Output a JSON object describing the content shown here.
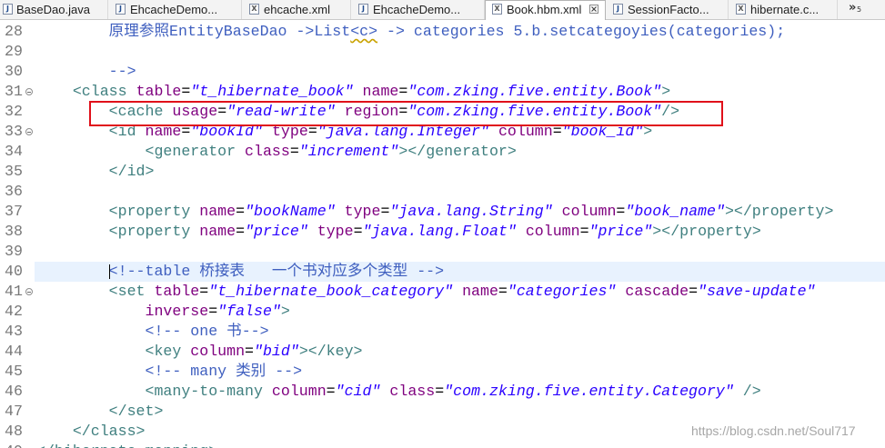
{
  "tabbar": {
    "tabs": [
      {
        "label": "BaseDao.java",
        "icon": "java-file-icon"
      },
      {
        "label": "EhcacheDemo...",
        "icon": "java-file-icon"
      },
      {
        "label": "ehcache.xml",
        "icon": "xml-file-icon"
      },
      {
        "label": "EhcacheDemo...",
        "icon": "java-file-icon"
      },
      {
        "label": "Book.hbm.xml",
        "icon": "xml-file-icon",
        "active": true,
        "closable": true
      },
      {
        "label": "SessionFacto...",
        "icon": "java-file-icon"
      },
      {
        "label": "hibernate.c...",
        "icon": "xml-file-icon"
      }
    ],
    "overflow_glyph": "»",
    "overflow_count": "5"
  },
  "editor": {
    "colors": {
      "tag": "#3f7f7f",
      "attr": "#7f007f",
      "val": "#2a00ff",
      "txt": "#000000",
      "cmt": "#3f5fbf",
      "line_number": "#787878",
      "current_line_bg": "#e8f2fe",
      "annotation": "#e0101a"
    },
    "lines": [
      {
        "n": "28",
        "tokens": [
          {
            "t": "cmt",
            "v": "        原理参照EntityBaseDao ->List"
          },
          {
            "t": "cmt",
            "v": "<c>",
            "u": true
          },
          {
            "t": "cmt",
            "v": " -> categories 5.b.setcategoyies(categories);"
          }
        ]
      },
      {
        "n": "29",
        "tokens": []
      },
      {
        "n": "30",
        "tokens": [
          {
            "t": "cmt",
            "v": "        -->"
          }
        ]
      },
      {
        "n": "31",
        "fold": true,
        "tokens": [
          {
            "t": "tag",
            "v": "    <class"
          },
          {
            "t": "txt",
            "v": " "
          },
          {
            "t": "attr",
            "v": "table"
          },
          {
            "t": "txt",
            "v": "="
          },
          {
            "t": "val",
            "v": "\"t_hibernate_book\""
          },
          {
            "t": "txt",
            "v": " "
          },
          {
            "t": "attr",
            "v": "name"
          },
          {
            "t": "txt",
            "v": "="
          },
          {
            "t": "val",
            "v": "\"com.zking.five.entity.Book\""
          },
          {
            "t": "tag",
            "v": ">"
          }
        ]
      },
      {
        "n": "32",
        "tokens": [
          {
            "t": "tag",
            "v": "        <cache"
          },
          {
            "t": "txt",
            "v": " "
          },
          {
            "t": "attr",
            "v": "usage"
          },
          {
            "t": "txt",
            "v": "="
          },
          {
            "t": "val",
            "v": "\"read-write\""
          },
          {
            "t": "txt",
            "v": " "
          },
          {
            "t": "attr",
            "v": "region"
          },
          {
            "t": "txt",
            "v": "="
          },
          {
            "t": "val",
            "v": "\"com.zking.five.entity.Book\""
          },
          {
            "t": "tag",
            "v": "/>"
          }
        ]
      },
      {
        "n": "33",
        "fold": true,
        "tokens": [
          {
            "t": "tag",
            "v": "        <id"
          },
          {
            "t": "txt",
            "v": " "
          },
          {
            "t": "attr",
            "v": "name"
          },
          {
            "t": "txt",
            "v": "="
          },
          {
            "t": "val",
            "v": "\"bookId\""
          },
          {
            "t": "txt",
            "v": " "
          },
          {
            "t": "attr",
            "v": "type"
          },
          {
            "t": "txt",
            "v": "="
          },
          {
            "t": "val",
            "v": "\"java.lang.Integer\""
          },
          {
            "t": "txt",
            "v": " "
          },
          {
            "t": "attr",
            "v": "column"
          },
          {
            "t": "txt",
            "v": "="
          },
          {
            "t": "val",
            "v": "\"book_id\""
          },
          {
            "t": "tag",
            "v": ">"
          }
        ]
      },
      {
        "n": "34",
        "tokens": [
          {
            "t": "tag",
            "v": "            <generator"
          },
          {
            "t": "txt",
            "v": " "
          },
          {
            "t": "attr",
            "v": "class"
          },
          {
            "t": "txt",
            "v": "="
          },
          {
            "t": "val",
            "v": "\"increment\""
          },
          {
            "t": "tag",
            "v": "></generator>"
          }
        ]
      },
      {
        "n": "35",
        "tokens": [
          {
            "t": "tag",
            "v": "        </id>"
          }
        ]
      },
      {
        "n": "36",
        "tokens": []
      },
      {
        "n": "37",
        "tokens": [
          {
            "t": "tag",
            "v": "        <property"
          },
          {
            "t": "txt",
            "v": " "
          },
          {
            "t": "attr",
            "v": "name"
          },
          {
            "t": "txt",
            "v": "="
          },
          {
            "t": "val",
            "v": "\"bookName\""
          },
          {
            "t": "txt",
            "v": " "
          },
          {
            "t": "attr",
            "v": "type"
          },
          {
            "t": "txt",
            "v": "="
          },
          {
            "t": "val",
            "v": "\"java.lang.String\""
          },
          {
            "t": "txt",
            "v": " "
          },
          {
            "t": "attr",
            "v": "column"
          },
          {
            "t": "txt",
            "v": "="
          },
          {
            "t": "val",
            "v": "\"book_name\""
          },
          {
            "t": "tag",
            "v": "></property>"
          }
        ]
      },
      {
        "n": "38",
        "tokens": [
          {
            "t": "tag",
            "v": "        <property"
          },
          {
            "t": "txt",
            "v": " "
          },
          {
            "t": "attr",
            "v": "name"
          },
          {
            "t": "txt",
            "v": "="
          },
          {
            "t": "val",
            "v": "\"price\""
          },
          {
            "t": "txt",
            "v": " "
          },
          {
            "t": "attr",
            "v": "type"
          },
          {
            "t": "txt",
            "v": "="
          },
          {
            "t": "val",
            "v": "\"java.lang.Float\""
          },
          {
            "t": "txt",
            "v": " "
          },
          {
            "t": "attr",
            "v": "column"
          },
          {
            "t": "txt",
            "v": "="
          },
          {
            "t": "val",
            "v": "\"price\""
          },
          {
            "t": "tag",
            "v": "></property>"
          }
        ]
      },
      {
        "n": "39",
        "tokens": []
      },
      {
        "n": "40",
        "current": true,
        "tokens": [
          {
            "t": "cmt",
            "v": "        <!--table 桥接表   一个书对应多个类型 -->"
          }
        ]
      },
      {
        "n": "41",
        "fold": true,
        "tokens": [
          {
            "t": "tag",
            "v": "        <set"
          },
          {
            "t": "txt",
            "v": " "
          },
          {
            "t": "attr",
            "v": "table"
          },
          {
            "t": "txt",
            "v": "="
          },
          {
            "t": "val",
            "v": "\"t_hibernate_book_category\""
          },
          {
            "t": "txt",
            "v": " "
          },
          {
            "t": "attr",
            "v": "name"
          },
          {
            "t": "txt",
            "v": "="
          },
          {
            "t": "val",
            "v": "\"categories\""
          },
          {
            "t": "txt",
            "v": " "
          },
          {
            "t": "attr",
            "v": "cascade"
          },
          {
            "t": "txt",
            "v": "="
          },
          {
            "t": "val",
            "v": "\"save-update\""
          }
        ]
      },
      {
        "n": "42",
        "tokens": [
          {
            "t": "attr",
            "v": "            inverse"
          },
          {
            "t": "txt",
            "v": "="
          },
          {
            "t": "val",
            "v": "\"false\""
          },
          {
            "t": "tag",
            "v": ">"
          }
        ]
      },
      {
        "n": "43",
        "tokens": [
          {
            "t": "cmt",
            "v": "            <!-- one 书-->"
          }
        ]
      },
      {
        "n": "44",
        "tokens": [
          {
            "t": "tag",
            "v": "            <key"
          },
          {
            "t": "txt",
            "v": " "
          },
          {
            "t": "attr",
            "v": "column"
          },
          {
            "t": "txt",
            "v": "="
          },
          {
            "t": "val",
            "v": "\"bid\""
          },
          {
            "t": "tag",
            "v": "></key>"
          }
        ]
      },
      {
        "n": "45",
        "tokens": [
          {
            "t": "cmt",
            "v": "            <!-- many 类别 -->"
          }
        ]
      },
      {
        "n": "46",
        "tokens": [
          {
            "t": "tag",
            "v": "            <many-to-many"
          },
          {
            "t": "txt",
            "v": " "
          },
          {
            "t": "attr",
            "v": "column"
          },
          {
            "t": "txt",
            "v": "="
          },
          {
            "t": "val",
            "v": "\"cid\""
          },
          {
            "t": "txt",
            "v": " "
          },
          {
            "t": "attr",
            "v": "class"
          },
          {
            "t": "txt",
            "v": "="
          },
          {
            "t": "val",
            "v": "\"com.zking.five.entity.Category\""
          },
          {
            "t": "txt",
            "v": " "
          },
          {
            "t": "tag",
            "v": "/>"
          }
        ]
      },
      {
        "n": "47",
        "tokens": [
          {
            "t": "tag",
            "v": "        </set>"
          }
        ]
      },
      {
        "n": "48",
        "tokens": [
          {
            "t": "tag",
            "v": "    </class>"
          }
        ]
      },
      {
        "n": "49",
        "tokens": [
          {
            "t": "tag",
            "v": "</hibernate-mapping>"
          }
        ]
      }
    ]
  },
  "watermark": "https://blog.csdn.net/Soul717"
}
